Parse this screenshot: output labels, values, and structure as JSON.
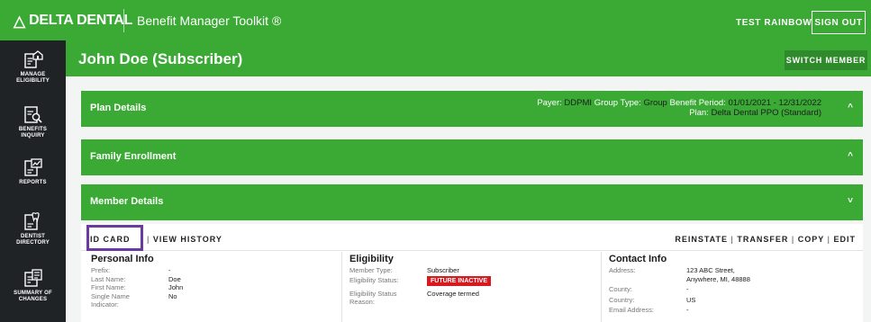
{
  "header": {
    "logo_text": "DELTA DENTAL",
    "logo_symbol": "△",
    "toolkit_title": "Benefit Manager Toolkit ®",
    "user_name": "TEST RAINBOW",
    "signout_label": "SIGN OUT"
  },
  "sidebar": {
    "items": [
      {
        "label_line1": "MANAGE",
        "label_line2": "ELIGIBILITY",
        "icon": "manage-eligibility-icon"
      },
      {
        "label_line1": "BENEFITS",
        "label_line2": "INQUIRY",
        "icon": "benefits-inquiry-icon"
      },
      {
        "label_line1": "REPORTS",
        "label_line2": "",
        "icon": "reports-icon"
      },
      {
        "label_line1": "DENTIST",
        "label_line2": "DIRECTORY",
        "icon": "dentist-directory-icon"
      },
      {
        "label_line1": "SUMMARY OF",
        "label_line2": "CHANGES",
        "icon": "summary-of-changes-icon"
      }
    ]
  },
  "page": {
    "title": "John Doe (Subscriber)",
    "switch_member_label": "SWITCH MEMBER"
  },
  "plan_details": {
    "title": "Plan Details",
    "payer_label": "Payer:",
    "payer_value": "DDPMI",
    "group_type_label": "Group Type:",
    "group_type_value": "Group",
    "benefit_period_label": "Benefit Period:",
    "benefit_period_value": "01/01/2021 - 12/31/2022",
    "plan_label": "Plan:",
    "plan_value": "Delta Dental PPO (Standard)",
    "chevron": "^"
  },
  "family_enrollment": {
    "title": "Family Enrollment",
    "chevron": "^"
  },
  "member_details": {
    "title": "Member Details",
    "chevron": "˅",
    "id_card_label": "ID CARD",
    "view_history_label": "VIEW HISTORY",
    "reinstate_label": "REINSTATE",
    "transfer_label": "TRANSFER",
    "copy_label": "COPY",
    "edit_label": "EDIT",
    "separator": "|"
  },
  "personal_info": {
    "title": "Personal Info",
    "rows": [
      {
        "k": "Prefix:",
        "v": "-"
      },
      {
        "k": "Last Name:",
        "v": "Doe"
      },
      {
        "k": "First Name:",
        "v": "John"
      },
      {
        "k": "Single Name Indicator:",
        "v": "No"
      }
    ]
  },
  "eligibility": {
    "title": "Eligibility",
    "member_type_label": "Member Type:",
    "member_type_value": "Subscriber",
    "status_label": "Eligibility Status:",
    "status_value": "FUTURE INACTIVE",
    "reason_label": "Eligibility Status Reason:",
    "reason_value": "Coverage termed",
    "status_color": "#d71920"
  },
  "contact_info": {
    "title": "Contact Info",
    "address_label": "Address:",
    "address_line1": "123 ABC Street,",
    "address_line2": "Anywhere, MI, 48888",
    "county_label": "County:",
    "county_value": "-",
    "country_label": "Country:",
    "country_value": "US",
    "email_label": "Email Address:",
    "email_value": "-"
  },
  "colors": {
    "brand_green": "#3aaa35",
    "sidebar_dark": "#1f2326",
    "highlight_purple": "#6b3aa0"
  }
}
